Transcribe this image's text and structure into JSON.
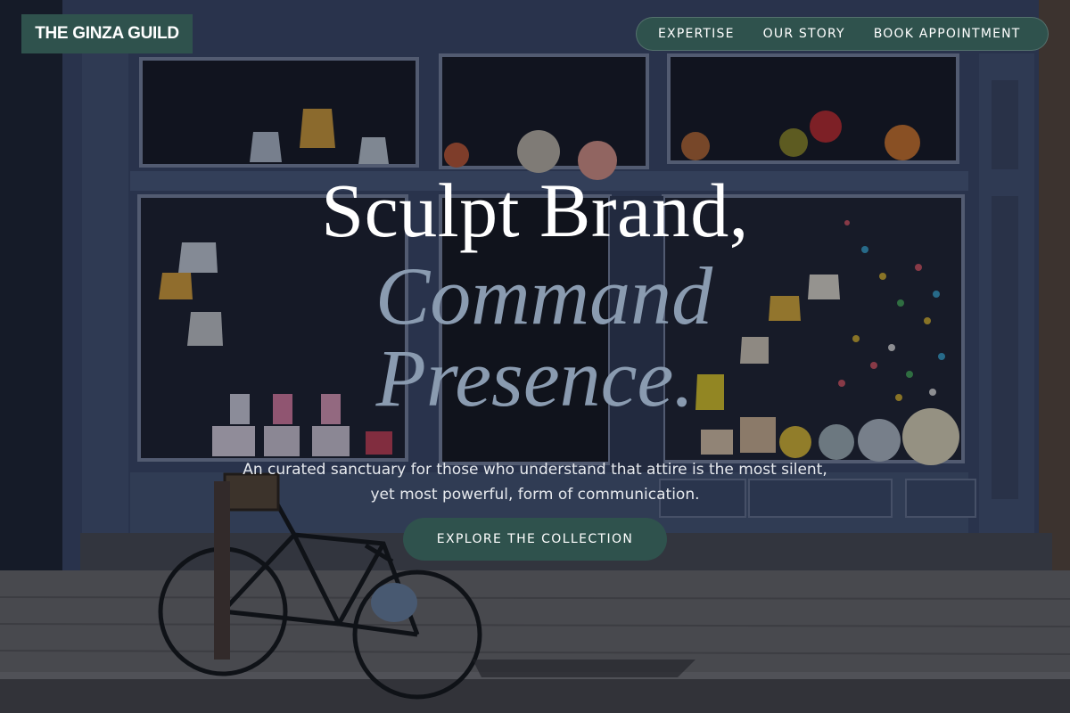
{
  "brand": {
    "name": "THE GINZA GUILD"
  },
  "nav": {
    "items": [
      "EXPERTISE",
      "OUR STORY",
      "BOOK APPOINTMENT"
    ]
  },
  "hero": {
    "headline_line1": "Sculpt Brand,",
    "headline_line2": "Command",
    "headline_line3": "Presence.",
    "subtitle": "An curated sanctuary for those who understand that attire is the most silent, yet most powerful, form of communication.",
    "cta_label": "EXPLORE THE COLLECTION",
    "background_description": "storefront-with-bicycle-photo"
  },
  "colors": {
    "accent": "#2f524d",
    "headline_white": "#ffffff",
    "headline_muted": "#8a9bb0"
  }
}
